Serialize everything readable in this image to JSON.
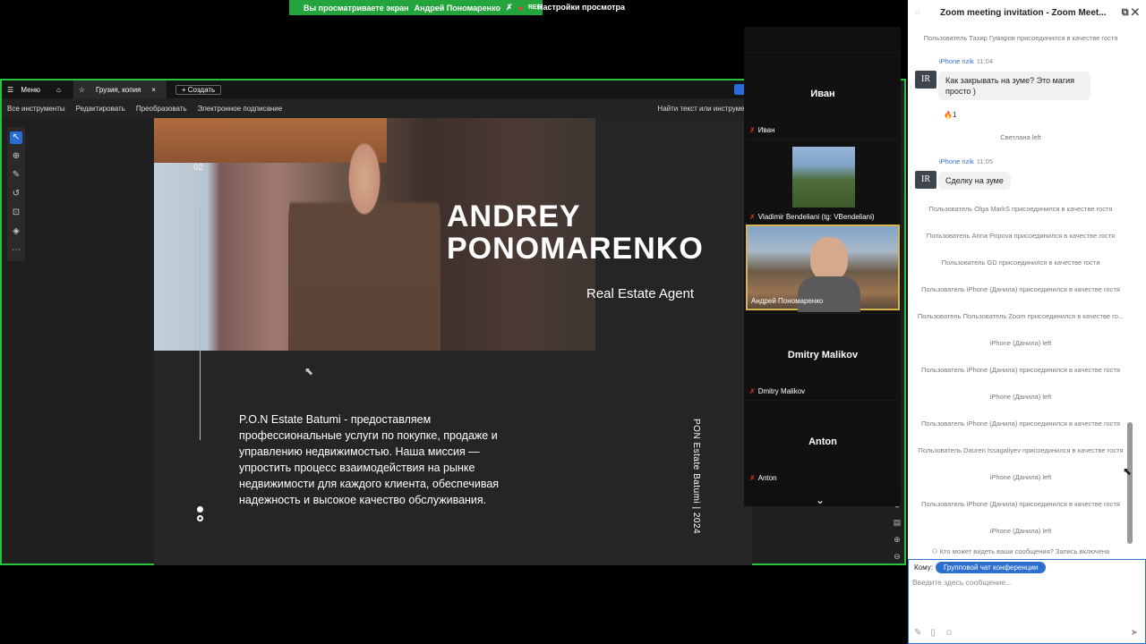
{
  "banner": {
    "text": "Вы просматриваете экран",
    "name": "Андрей Пономаренко",
    "rec": "REC",
    "settings": "Настройки просмотра"
  },
  "acrobat": {
    "menu": "Меню",
    "tab": "Грузия, копия",
    "create": "+ Создать",
    "menu_items": [
      "Все инструменты",
      "Редактировать",
      "Преобразовать",
      "Электронное подписание"
    ],
    "find": "Найти текст или инструмен"
  },
  "slide": {
    "page_num": "02",
    "name_line1": "ANDREY",
    "name_line2": "PONOMARENKO",
    "role": "Real Estate Agent",
    "description": "P.O.N Estate Batumi - предоставляем профессиональные услуги по покупке, продаже и управлению недвижимостью. Наша миссия — упростить процесс взаимодействия на рынке недвижимости для каждого клиента, обеспечивая надежность и высокое качество обслуживания.",
    "vertical": "PON Estate Batumi | 2024"
  },
  "gallery": [
    {
      "big": "Иван",
      "label": "Иван"
    },
    {
      "big": "",
      "label": "Vladimir Bendeliani (tg: VBendeliani)"
    },
    {
      "big": "",
      "label": "Андрей Пономаренко"
    },
    {
      "big": "Dmitry Malikov",
      "label": "Dmitry Malikov"
    },
    {
      "big": "Anton",
      "label": "Anton"
    }
  ],
  "chat": {
    "title": "Zoom meeting invitation - Zoom Meet...",
    "m1": "Пользователь Тахир Гумаров присоединился в качестве гостя",
    "s1_name": "iPhone rizik",
    "s1_time": "11:04",
    "b1": "Как закрывать на зуме? Это магия просто )",
    "reaction": "🔥1",
    "m2": "Светлана left",
    "s2_name": "iPhone rizik",
    "s2_time": "11:05",
    "b2": "Сделку на зуме",
    "events": [
      "Пользователь Olga MarkS присоединился в качестве гостя",
      "Пользователь Anna Popova присоединился в качестве гостя",
      "Пользователь GD присоединился в качестве гостя",
      "Пользователь iPhone (Данила) присоединился в качестве гостя",
      "Пользователь Пользователь Zoom присоединился в качестве го...",
      "iPhone (Данила) left",
      "Пользователь iPhone (Данила) присоединился в качестве гостя",
      "iPhone (Данила) left",
      "Пользователь iPhone (Данила) присоединился в качестве гостя",
      "Пользователь Dauren Issagaliyev присоединился в качестве гостя",
      "iPhone (Данила) left",
      "Пользователь iPhone (Данила) присоединился в качестве гостя",
      "iPhone (Данила) left"
    ],
    "notice": "Кто может видеть ваши сообщения? Запись включена",
    "to_label": "Кому:",
    "to_value": "Групповой чат конференции",
    "placeholder": "Введите здесь сообщение..."
  }
}
